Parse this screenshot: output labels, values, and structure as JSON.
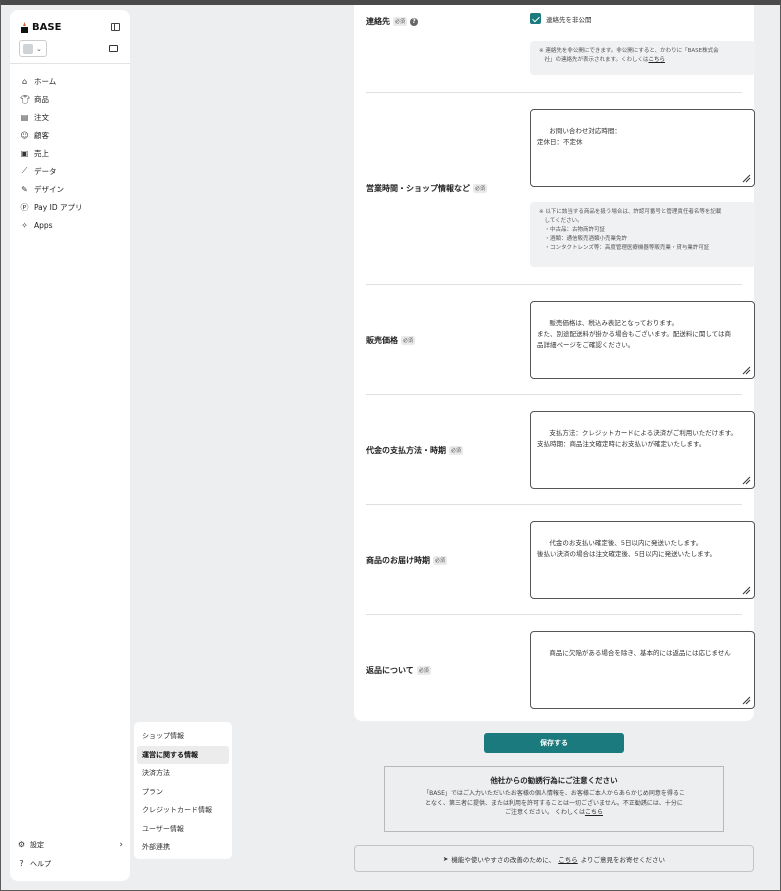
{
  "sidebar": {
    "logo": "BASE",
    "nav": [
      {
        "icon": "home-icon",
        "label": "ホーム"
      },
      {
        "icon": "shirt-icon",
        "label": "商品"
      },
      {
        "icon": "order-icon",
        "label": "注文"
      },
      {
        "icon": "user-icon",
        "label": "顧客"
      },
      {
        "icon": "wallet-icon",
        "label": "売上"
      },
      {
        "icon": "chart-icon",
        "label": "データ"
      },
      {
        "icon": "brush-icon",
        "label": "デザイン"
      },
      {
        "icon": "payid-icon",
        "label": "Pay ID アプリ"
      },
      {
        "icon": "apps-icon",
        "label": "Apps"
      }
    ],
    "settings": "設定",
    "help": "ヘルプ"
  },
  "submenu": {
    "items": [
      {
        "label": "ショップ情報",
        "active": false
      },
      {
        "label": "運営に関する情報",
        "active": true
      },
      {
        "label": "決済方法",
        "active": false
      },
      {
        "label": "プラン",
        "active": false
      },
      {
        "label": "クレジットカード情報",
        "active": false
      },
      {
        "label": "ユーザー情報",
        "active": false
      },
      {
        "label": "外部連携",
        "active": false
      }
    ]
  },
  "form": {
    "required_badge": "必須",
    "contact": {
      "label": "連絡先",
      "checkbox_label": "連絡先を非公開",
      "checked": true,
      "note": "※ 連絡先を非公開にできます。非公開にすると、かわりに「BASE株式会\n　社」の連絡先が表示されます。くわしくは",
      "note_link": "こちら"
    },
    "hours": {
      "label": "営業時間・ショップ情報など",
      "value": "お問い合わせ対応時間：\n定休日：不定休",
      "note": "※ 以下に該当する商品を扱う場合は、許認可番号と管理責任者名等を記載\n　してください。\n　・中古品：古物商許可証\n　・酒類：通信販売酒類小売業免許\n　・コンタクトレンズ等：高度管理医療機器等販売業・貸与業許可証"
    },
    "price": {
      "label": "販売価格",
      "value": "販売価格は、税込み表記となっております。\nまた、別途配送料が掛かる場合もございます。配送料に関しては商\n品詳細ページをご確認ください。"
    },
    "payment": {
      "label": "代金の支払方法・時期",
      "value": "支払方法：クレジットカードによる決済がご利用いただけます。\n支払時期：商品注文確定時にお支払いが確定いたします。"
    },
    "delivery": {
      "label": "商品のお届け時期",
      "value": "代金のお支払い確定後、5日以内に発送いたします。\n後払い決済の場合は注文確定後、5日以内に発送いたします。"
    },
    "returns": {
      "label": "返品について",
      "value": "商品に欠陥がある場合を除き、基本的には返品には応じません"
    }
  },
  "save_button": "保存する",
  "warning": {
    "title": "他社からの勧誘行為にご注意ください",
    "body": "「BASE」ではご入力いただいたお客様の個人情報を、お客様ご本人からあらかじめ同意を得るこ\nとなく、第三者に提供、または利用を許可することは一切ございません。不正勧誘には、十分に\nご注意ください。 くわしくは",
    "link": "こちら"
  },
  "feedback": {
    "prefix": "機能や使いやすさの改善のために、",
    "link": "こちら",
    "suffix": "よりご意見をお寄せください"
  }
}
